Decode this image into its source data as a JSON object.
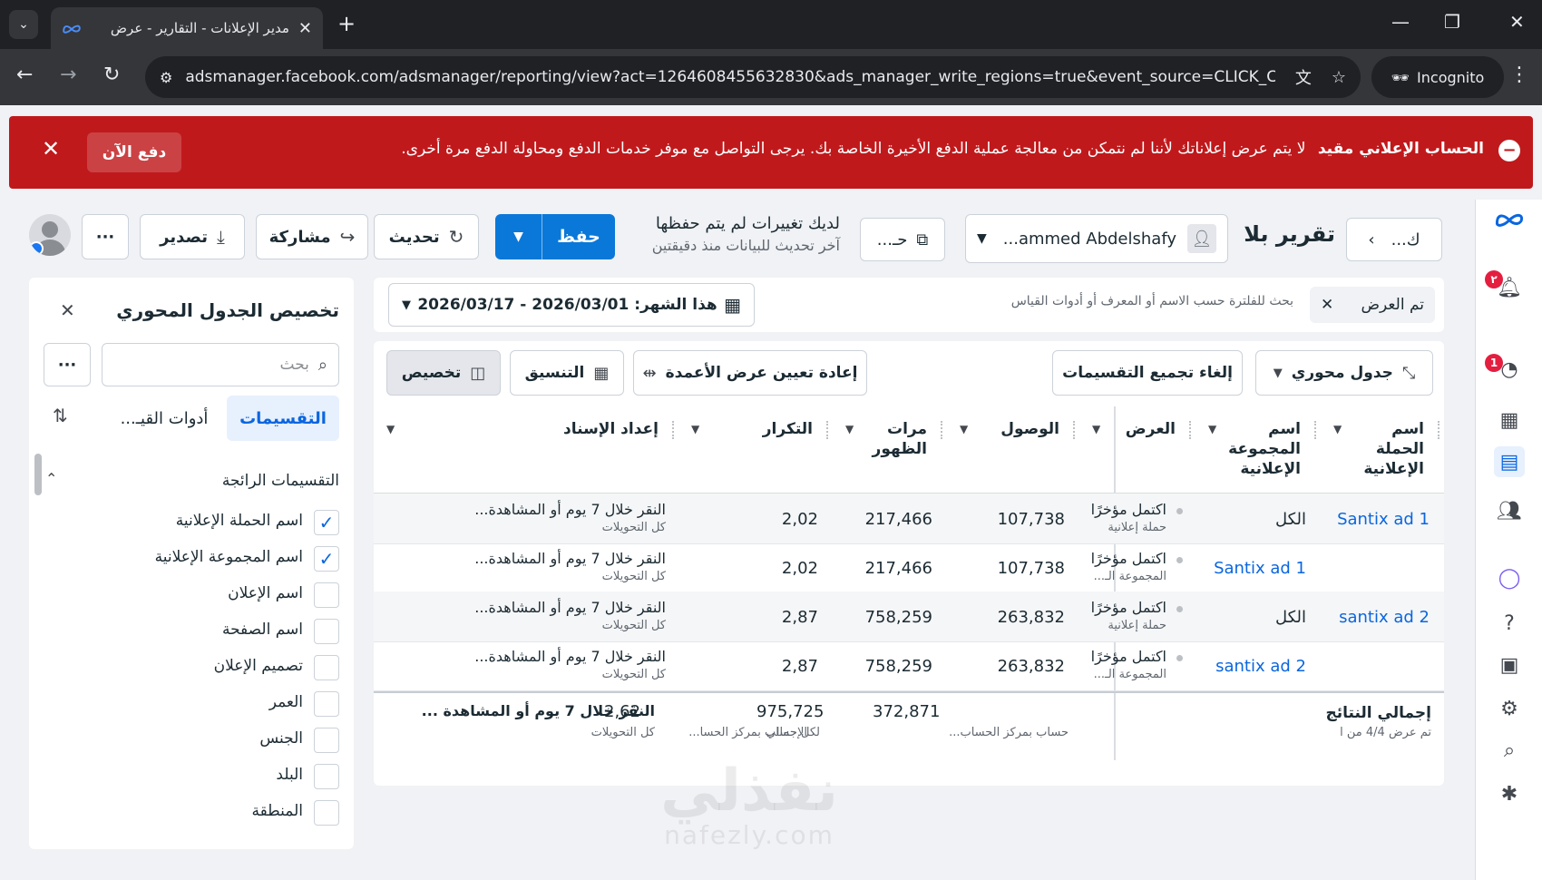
{
  "browser": {
    "tab_title": "مدير الإعلانات - التقارير - عرض",
    "url": "adsmanager.facebook.com/adsmanager/reporting/view?act=1264608455632830&ads_manager_write_regions=true&event_source=CLICK_CRE...",
    "incognito_label": "Incognito"
  },
  "alert": {
    "title": "الحساب الإعلاني مقيد",
    "message": "لا يتم عرض إعلاناتك لأننا لم نتمكن من معالجة عملية الدفع الأخيرة الخاصة بك. يرجى التواصل مع موفر خدمات الدفع ومحاولة الدفع مرة أخرى.",
    "pay_now": "دفع الآن"
  },
  "header": {
    "back_label": "ك...",
    "report_title": "تقرير بلا",
    "account_name": "...ammed Abdelshafy",
    "view_label": "حـ...",
    "unsaved_title": "لديك تغييرات لم يتم حفظها",
    "unsaved_sub": "آخر تحديث للبيانات منذ دقيقتين",
    "save": "حفظ",
    "refresh": "تحديث",
    "share": "مشاركة",
    "export": "تصدير",
    "more": "···"
  },
  "panel": {
    "title": "تخصيص الجدول المحوري",
    "search_placeholder": "بحث",
    "more": "···",
    "tabs": [
      {
        "label": "التقسيمات"
      },
      {
        "label": "أدوات القيـ..."
      }
    ],
    "section_title": "التقسيمات الرائجة",
    "items": [
      {
        "label": "اسم الحملة الإعلانية",
        "checked": true
      },
      {
        "label": "اسم المجموعة الإعلانية",
        "checked": true
      },
      {
        "label": "اسم الإعلان",
        "checked": false
      },
      {
        "label": "اسم الصفحة",
        "checked": false
      },
      {
        "label": "تصميم الإعلان",
        "checked": false
      },
      {
        "label": "العمر",
        "checked": false
      },
      {
        "label": "الجنس",
        "checked": false
      },
      {
        "label": "البلد",
        "checked": false
      },
      {
        "label": "المنطقة",
        "checked": false
      }
    ]
  },
  "filter": {
    "chip": "تم العرض",
    "placeholder": "بحث للفلترة حسب الاسم أو المعرف أو أدوات القياس",
    "date_range": "هذا الشهر: 2026/03/01 - 2026/03/17"
  },
  "toolbar": {
    "pivot": "جدول محوري",
    "ungroup": "إلغاء تجميع التقسيمات",
    "reset_cols": "إعادة تعيين عرض الأعمدة",
    "format": "التنسيق",
    "customize": "تخصيص"
  },
  "table": {
    "columns": [
      {
        "label": "اسم الحملة الإعلانية"
      },
      {
        "label": "اسم المجموعة الإعلانية"
      },
      {
        "label": "العرض"
      },
      {
        "label": "الوصول"
      },
      {
        "label": "مرات الظهور"
      },
      {
        "label": "التكرار"
      },
      {
        "label": "إعداد الإسناد"
      }
    ],
    "rows": [
      {
        "campaign": "Santix ad 1",
        "adset": "الكل",
        "delivery": "اكتمل مؤخرًا",
        "delivery_sub": "حملة إعلانية",
        "reach": "107,738",
        "impressions": "217,466",
        "frequency": "2,02",
        "attr": "النقر خلال 7 يوم أو المشاهدة...",
        "attr_sub": "كل التحويلات"
      },
      {
        "campaign": "",
        "adset": "Santix ad 1",
        "delivery": "اكتمل مؤخرًا",
        "delivery_sub": "المجموعة الـ...",
        "reach": "107,738",
        "impressions": "217,466",
        "frequency": "2,02",
        "attr": "النقر خلال 7 يوم أو المشاهدة...",
        "attr_sub": "كل التحويلات"
      },
      {
        "campaign": "santix ad 2",
        "adset": "الكل",
        "delivery": "اكتمل مؤخرًا",
        "delivery_sub": "حملة إعلانية",
        "reach": "263,832",
        "impressions": "758,259",
        "frequency": "2,87",
        "attr": "النقر خلال 7 يوم أو المشاهدة...",
        "attr_sub": "كل التحويلات"
      },
      {
        "campaign": "",
        "adset": "santix ad 2",
        "delivery": "اكتمل مؤخرًا",
        "delivery_sub": "المجموعة الـ...",
        "reach": "263,832",
        "impressions": "758,259",
        "frequency": "2,87",
        "attr": "النقر خلال 7 يوم أو المشاهدة...",
        "attr_sub": "كل التحويلات"
      }
    ],
    "totals": {
      "label": "إجمالي النتائج",
      "sub": "تم عرض 4/4 من ا",
      "reach": "372,871",
      "reach_sub": "حساب بمركز الحساب...",
      "impressions": "975,725",
      "impressions_sub": "الإجمالي",
      "frequency": "2,62",
      "frequency_sub": "لكل حساب بمركز الحسا...",
      "attr": "النقر خلال 7 يوم أو المشاهدة ...",
      "attr_sub": "كل التحويلات"
    }
  },
  "rail": {
    "notif_badge": "٢",
    "alerts_badge": "1"
  },
  "watermark": {
    "arabic": "نفذلي",
    "latin": "nafezly.com"
  },
  "colors": {
    "alert_red": "#c0191c",
    "primary_blue": "#0a78d9",
    "link_blue": "#0a66e0"
  }
}
